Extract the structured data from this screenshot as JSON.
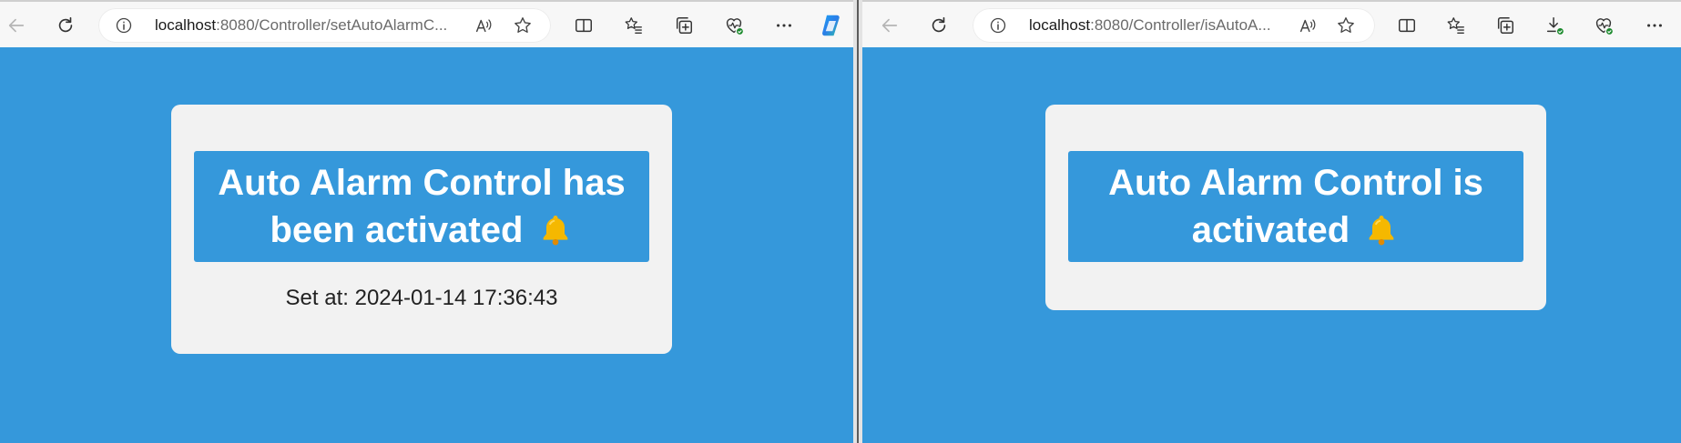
{
  "left_window": {
    "url": {
      "host": "localhost",
      "path": ":8080/Controller/setAutoAlarmC..."
    },
    "card": {
      "line1": "Auto Alarm Control has",
      "line2": "been activated",
      "bell_emoji": "bell-icon",
      "set_at": "Set at: 2024-01-14 17:36:43"
    }
  },
  "right_window": {
    "url": {
      "host": "localhost",
      "path": ":8080/Controller/isAutoA..."
    },
    "card": {
      "line1": "Auto Alarm Control is",
      "line2": "activated",
      "bell_emoji": "bell-icon"
    }
  },
  "colors": {
    "page_bg": "#3598db",
    "card_bg": "#f2f2f2",
    "banner_bg": "#3598db",
    "bell": "#f5b800"
  }
}
